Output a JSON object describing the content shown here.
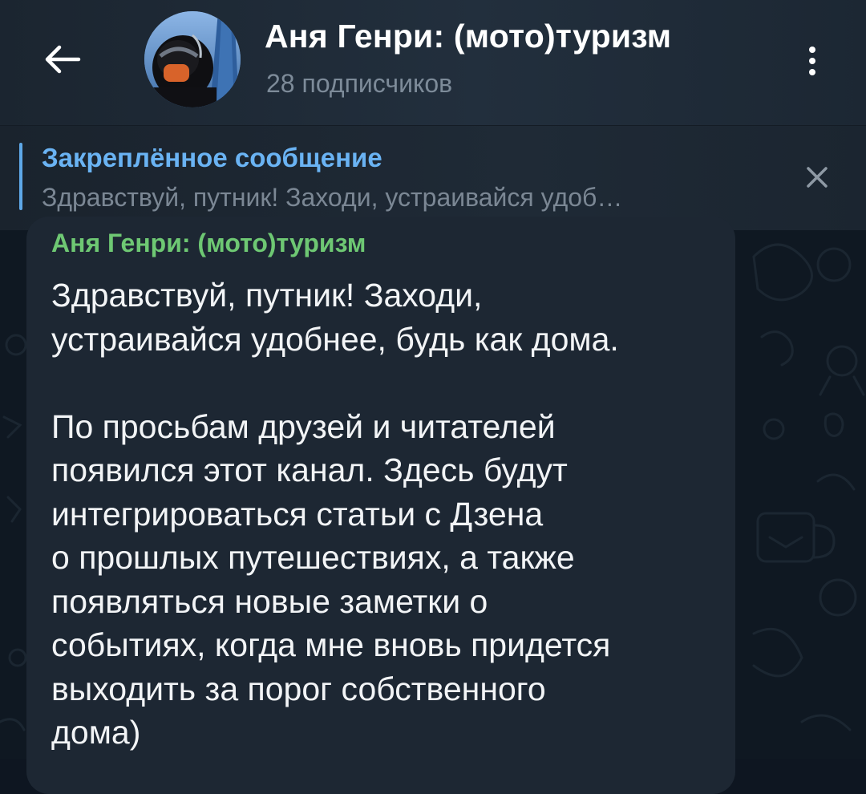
{
  "header": {
    "back_icon": "arrow-left-icon",
    "channel_title": "Аня Генри: (мото)туризм",
    "subscribers": "28 подписчиков",
    "menu_icon": "more-vertical-icon"
  },
  "pinned": {
    "title": "Закреплённое сообщение",
    "preview": "Здравствуй, путник! Заходи, устраивайся удоб…",
    "close_icon": "close-icon"
  },
  "message": {
    "sender": "Аня Генри: (мото)туризм",
    "text": "Здравствуй, путник! Заходи,\nустраивайся удобнее, будь как дома.\n\nПо просьбам друзей и читателей\nпоявился этот канал. Здесь будут\nинтегрироваться статьи с Дзена\nо прошлых путешествиях, а также\nпоявляться новые заметки о\nсобытиях, когда мне вновь придется\nвыходить за порог собственного\nдома)"
  },
  "colors": {
    "header_bg": "#222f3d",
    "chat_bg": "#0f1822",
    "bubble_bg": "#1d2733",
    "accent_blue": "#6ab3f3",
    "sender_green": "#6ec873",
    "muted_text": "#7b8794"
  }
}
